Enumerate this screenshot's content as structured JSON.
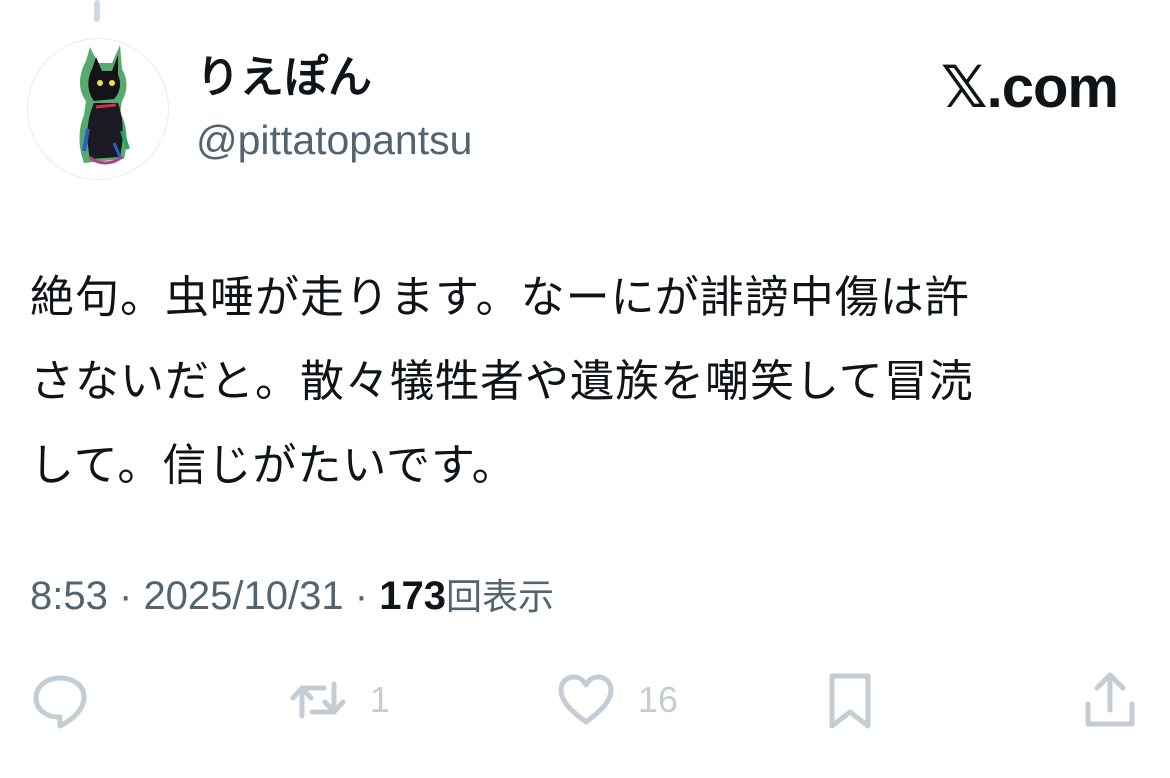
{
  "author": {
    "display_name": "りえぽん",
    "handle": "@pittatopantsu",
    "avatar_icon": "cat-illustration-avatar"
  },
  "brand": {
    "label": "𝕏.com"
  },
  "tweet": {
    "lines": [
      "絶句。虫唾が走ります。なーにが誹謗中傷は許",
      "さないだと。散々犠牲者や遺族を嘲笑して冒涜",
      "して。信じがたいです。"
    ]
  },
  "meta": {
    "time": "8:53",
    "separator": "·",
    "date": "2025/10/31",
    "view_count": "173",
    "view_label": "回表示"
  },
  "actions": {
    "reply": {
      "icon": "reply-bubble-icon"
    },
    "repost": {
      "icon": "repost-icon",
      "count": "1"
    },
    "like": {
      "icon": "heart-icon",
      "count": "16"
    },
    "bookmark": {
      "icon": "bookmark-icon"
    },
    "share": {
      "icon": "share-icon"
    }
  },
  "colors": {
    "text_primary": "#0f1419",
    "text_secondary": "#536471",
    "action_icon": "#c4cdd4",
    "thread_line": "#cfd9de"
  }
}
